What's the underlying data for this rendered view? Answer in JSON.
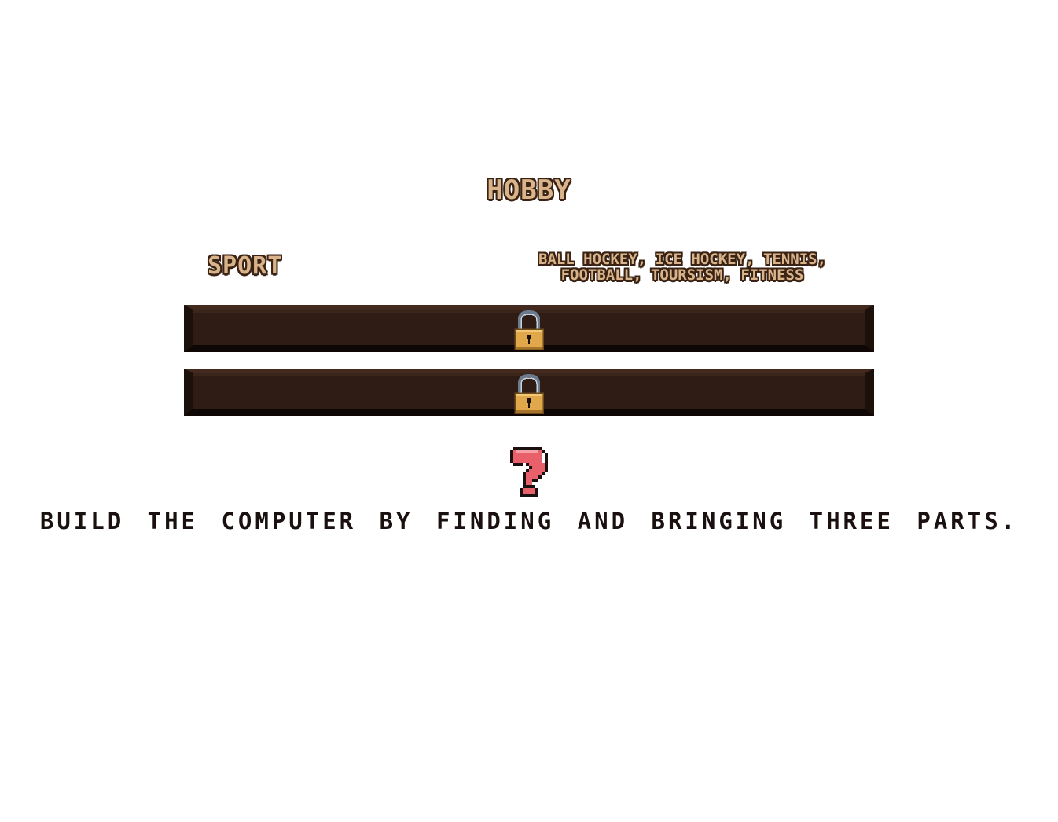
{
  "header": {
    "title": "HOBBY"
  },
  "entry": {
    "category": "SPORT",
    "description": "BALL HOCKEY, ICE HOCKEY, TENNIS, FOOTBALL, TOURSISM, FITNESS"
  },
  "slots": [
    {
      "state": "locked",
      "icon": "padlock-icon"
    },
    {
      "state": "locked",
      "icon": "padlock-icon"
    }
  ],
  "hint": {
    "icon": "question-mark-icon",
    "text": "BUILD THE COMPUTER BY FINDING AND BRINGING THREE PARTS."
  },
  "colors": {
    "background": "#ffffff",
    "title_fill": "#d9b48a",
    "title_outline": "#3a2314",
    "slot_body": "#2f1d15",
    "lock_gold": "#e0a84a",
    "hint_icon": "#e8606a",
    "hint_text": "#1a1010"
  }
}
